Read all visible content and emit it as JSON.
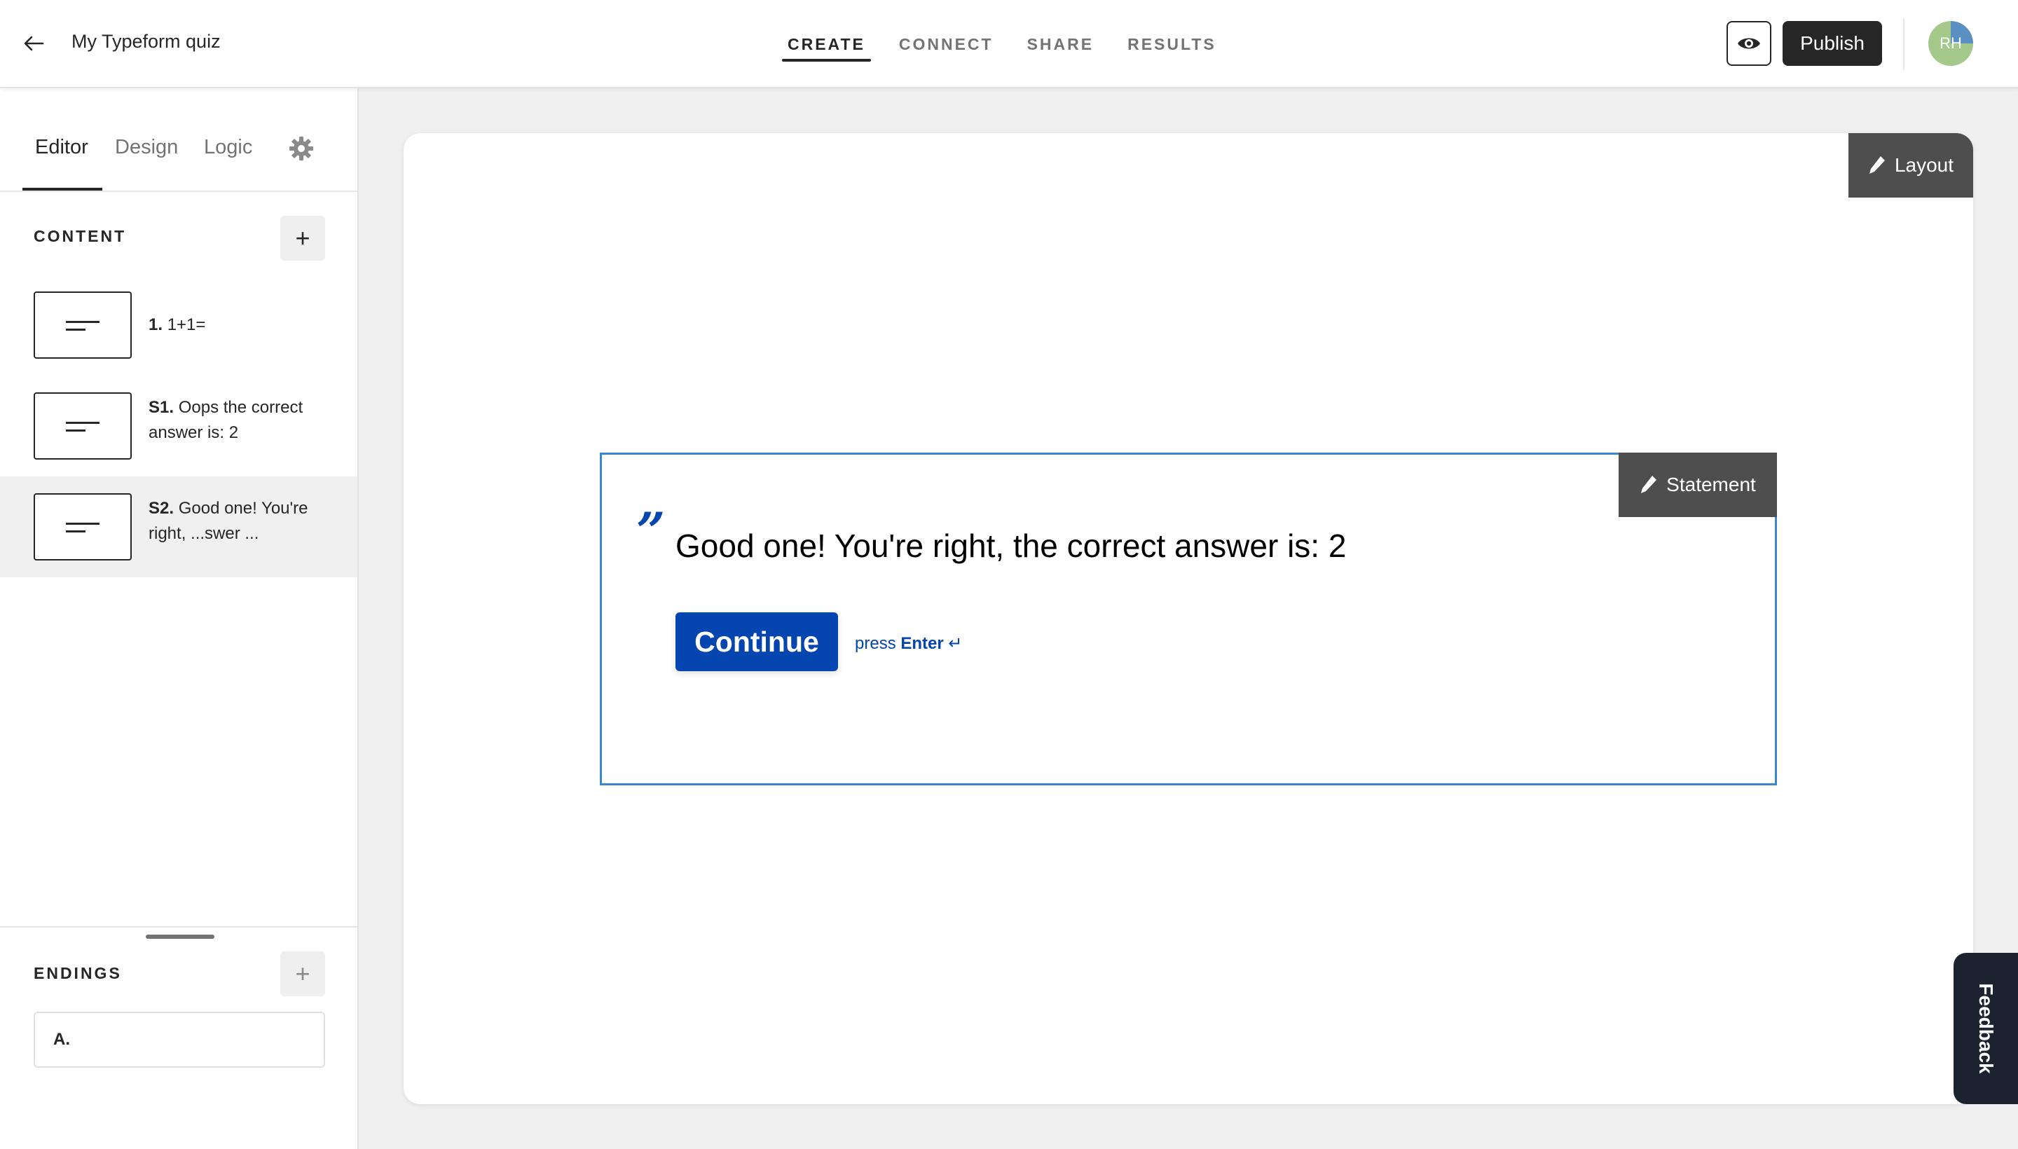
{
  "header": {
    "title": "My Typeform quiz",
    "tabs": [
      {
        "label": "CREATE",
        "active": true
      },
      {
        "label": "CONNECT",
        "active": false
      },
      {
        "label": "SHARE",
        "active": false
      },
      {
        "label": "RESULTS",
        "active": false
      }
    ],
    "publish_label": "Publish",
    "avatar_initials": "RH"
  },
  "sidebar": {
    "tabs": [
      {
        "label": "Editor",
        "active": true
      },
      {
        "label": "Design",
        "active": false
      },
      {
        "label": "Logic",
        "active": false
      }
    ],
    "content_label": "CONTENT",
    "items": [
      {
        "number": "1.",
        "text": "1+1=",
        "selected": false
      },
      {
        "number": "S1.",
        "text": "Oops the correct answer is: 2",
        "selected": false
      },
      {
        "number": "S2.",
        "text": "Good one! You're right, ...swer ...",
        "selected": true
      }
    ],
    "endings_label": "ENDINGS",
    "endings": [
      {
        "label": "A."
      }
    ]
  },
  "canvas": {
    "layout_label": "Layout",
    "statement_tag": "Statement",
    "quote": "”",
    "statement_text": "Good one! You're right, the correct answer is: 2",
    "continue_label": "Continue",
    "press_label": "press",
    "enter_label": "Enter",
    "enter_symbol": "↵"
  },
  "feedback_label": "Feedback",
  "colors": {
    "accent": "#0445af",
    "selection_border": "#3b86d3",
    "dark": "#262627",
    "tag_bg": "#4e4e4e"
  }
}
